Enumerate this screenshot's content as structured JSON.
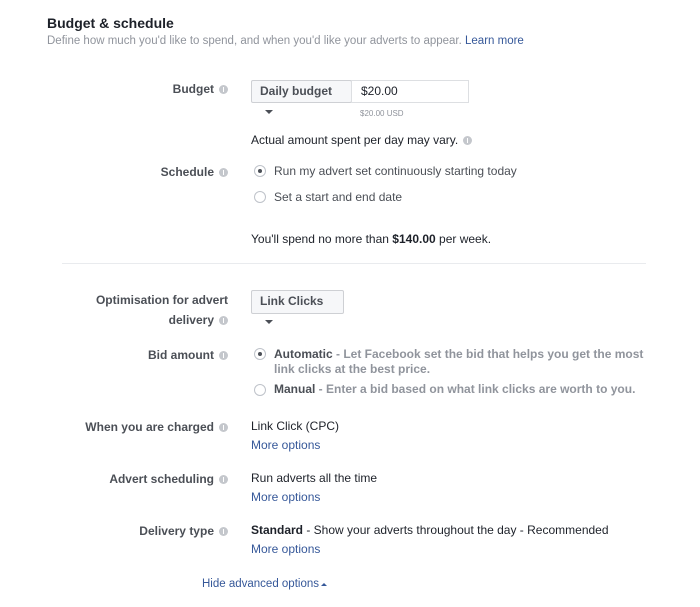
{
  "section": {
    "title": "Budget & schedule",
    "description": "Define how much you'd like to spend, and when you'd like your adverts to appear.",
    "learn_more": "Learn more"
  },
  "budget": {
    "label": "Budget",
    "type": "Daily budget",
    "value": "$20.00",
    "converted": "$20.00 USD",
    "note": "Actual amount spent per day may vary."
  },
  "schedule": {
    "label": "Schedule",
    "options": [
      "Run my advert set continuously starting today",
      "Set a start and end date"
    ],
    "selected": 0,
    "summary_pre": "You'll spend no more than",
    "summary_amount": "$140.00",
    "summary_post": "per week."
  },
  "optimisation": {
    "label_line1": "Optimisation for advert",
    "label_line2": "delivery",
    "value": "Link Clicks"
  },
  "bid": {
    "label": "Bid amount",
    "options": [
      {
        "title": "Automatic",
        "desc": " - Let Facebook set the bid that helps you get the most",
        "desc2": "link clicks at the best price."
      },
      {
        "title": "Manual",
        "desc": " - Enter a bid based on what link clicks are worth to you."
      }
    ],
    "selected": 0
  },
  "charged": {
    "label": "When you are charged",
    "value": "Link Click (CPC)",
    "more": "More options"
  },
  "ad_scheduling": {
    "label": "Advert scheduling",
    "value": "Run adverts all the time",
    "more": "More options"
  },
  "delivery": {
    "label": "Delivery type",
    "value_bold": "Standard",
    "value_rest": " - Show your adverts throughout the day - Recommended",
    "more": "More options"
  },
  "hide_advanced": "Hide advanced options"
}
